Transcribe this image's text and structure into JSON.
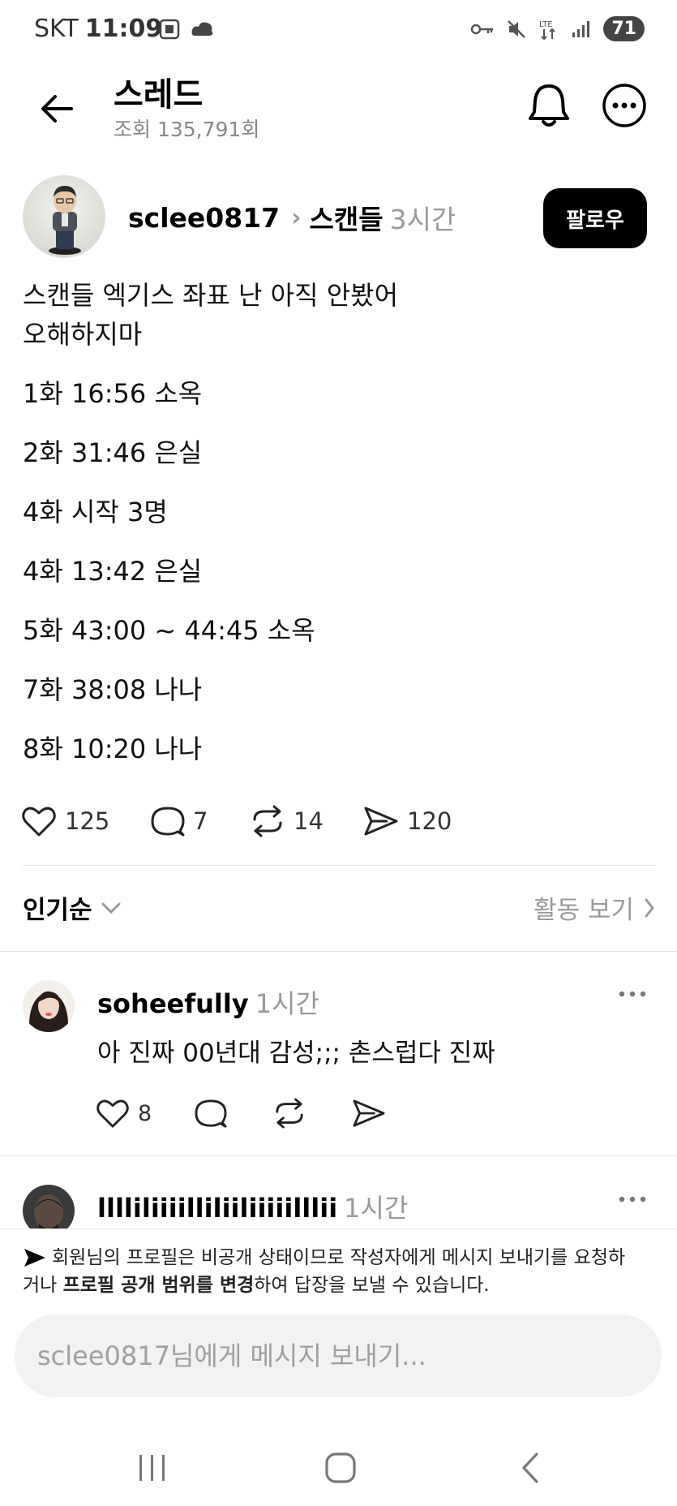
{
  "status_bar": {
    "carrier": "SKT",
    "time": "11:09",
    "battery": "71"
  },
  "header": {
    "title": "스레드",
    "views": "조회 135,791회"
  },
  "post": {
    "username": "sclee0817",
    "community": "스캔들",
    "time_ago": "3시간",
    "follow_label": "팔로우",
    "lines": [
      "스캔들 엑기스 좌표 난 아직 안봤어",
      "오해하지마",
      "1화 16:56 소옥",
      "2화 31:46 은실",
      "4화 시작 3명",
      "4화 13:42 은실",
      "5화 43:00 ~ 44:45 소옥",
      "7화 38:08 나나",
      "8화 10:20 나나"
    ],
    "likes": "125",
    "comments": "7",
    "reposts": "14",
    "shares": "120"
  },
  "sort": {
    "label": "인기순",
    "activity_label": "활동 보기"
  },
  "comments": [
    {
      "username": "soheefully",
      "time_ago": "1시간",
      "text": "아 진짜 00년대 감성;;; 촌스럽다 진짜",
      "likes": "8"
    },
    {
      "username": "lllliliiiilliliiliiiiilllii",
      "time_ago": "1시간"
    }
  ],
  "notice": {
    "part1": "회원님의 프로필은 비공개 상태이므로 작성자에게 메시지 보내기를 요청하거나 ",
    "bold": "프로필 공개 범위를 변경",
    "part2": "하여 답장을 보낼 수 있습니다."
  },
  "message_input": {
    "placeholder": "sclee0817님에게 메시지 보내기..."
  },
  "colors": {
    "accent": "#000000",
    "muted": "#999999",
    "input_bg": "#f2f2f2"
  }
}
